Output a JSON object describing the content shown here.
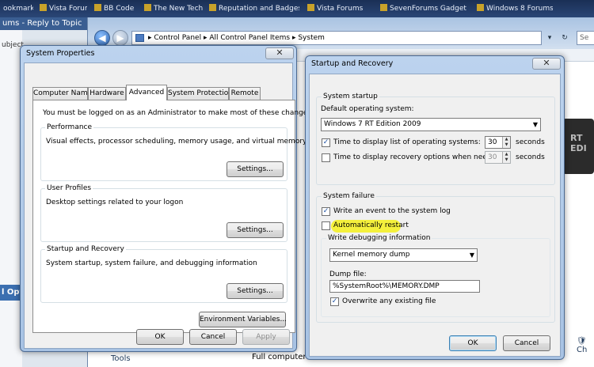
{
  "browser": {
    "tabs": [
      "ookmarks",
      "Vista Forums",
      "BB Code",
      "The New Tech",
      "Reputation and Badges",
      "Vista Forums",
      "SevenForums Gadget",
      "Windows 8 Forums"
    ],
    "window_title": "ums - Reply to Topic",
    "left_bar_label": "l Opt",
    "side_fragment": "ubject"
  },
  "explorer": {
    "address_parts": [
      "Control Panel",
      "All Control Panel Items",
      "System"
    ],
    "search_placeholder": "Se",
    "tools_label": "Tools",
    "full_computer": "Full computer n",
    "ch_label": "Ch",
    "right_panel_text": "RT EDI"
  },
  "system_properties": {
    "title": "System Properties",
    "close": "✕",
    "tabs": [
      "Computer Name",
      "Hardware",
      "Advanced",
      "System Protection",
      "Remote"
    ],
    "admin_note": "You must be logged on as an Administrator to make most of these changes.",
    "groups": [
      {
        "title": "Performance",
        "desc": "Visual effects, processor scheduling, memory usage, and virtual memory",
        "button": "Settings..."
      },
      {
        "title": "User Profiles",
        "desc": "Desktop settings related to your logon",
        "button": "Settings..."
      },
      {
        "title": "Startup and Recovery",
        "desc": "System startup, system failure, and debugging information",
        "button": "Settings..."
      }
    ],
    "env_button": "Environment Variables...",
    "ok": "OK",
    "cancel": "Cancel",
    "apply": "Apply"
  },
  "startup_recovery": {
    "title": "Startup and Recovery",
    "close": "✕",
    "system_startup": {
      "title": "System startup",
      "default_os_label": "Default operating system:",
      "default_os_value": "Windows 7 RT Edition 2009",
      "time_list_label": "Time to display list of operating systems:",
      "time_list_checked": true,
      "time_list_value": "30",
      "time_recovery_label": "Time to display recovery options when needed:",
      "time_recovery_checked": false,
      "time_recovery_value": "30",
      "seconds": "seconds"
    },
    "system_failure": {
      "title": "System failure",
      "write_event_label": "Write an event to the system log",
      "write_event_checked": true,
      "auto_restart_label": "Automatically restart",
      "auto_restart_checked": false,
      "debug_info_title": "Write debugging information",
      "debug_type_value": "Kernel memory dump",
      "dump_file_label": "Dump file:",
      "dump_file_value": "%SystemRoot%\\MEMORY.DMP",
      "overwrite_label": "Overwrite any existing file",
      "overwrite_checked": true
    },
    "ok": "OK",
    "cancel": "Cancel"
  },
  "colors": {
    "highlight": "#f4f01c",
    "title_blue": "#a7c2e3"
  }
}
